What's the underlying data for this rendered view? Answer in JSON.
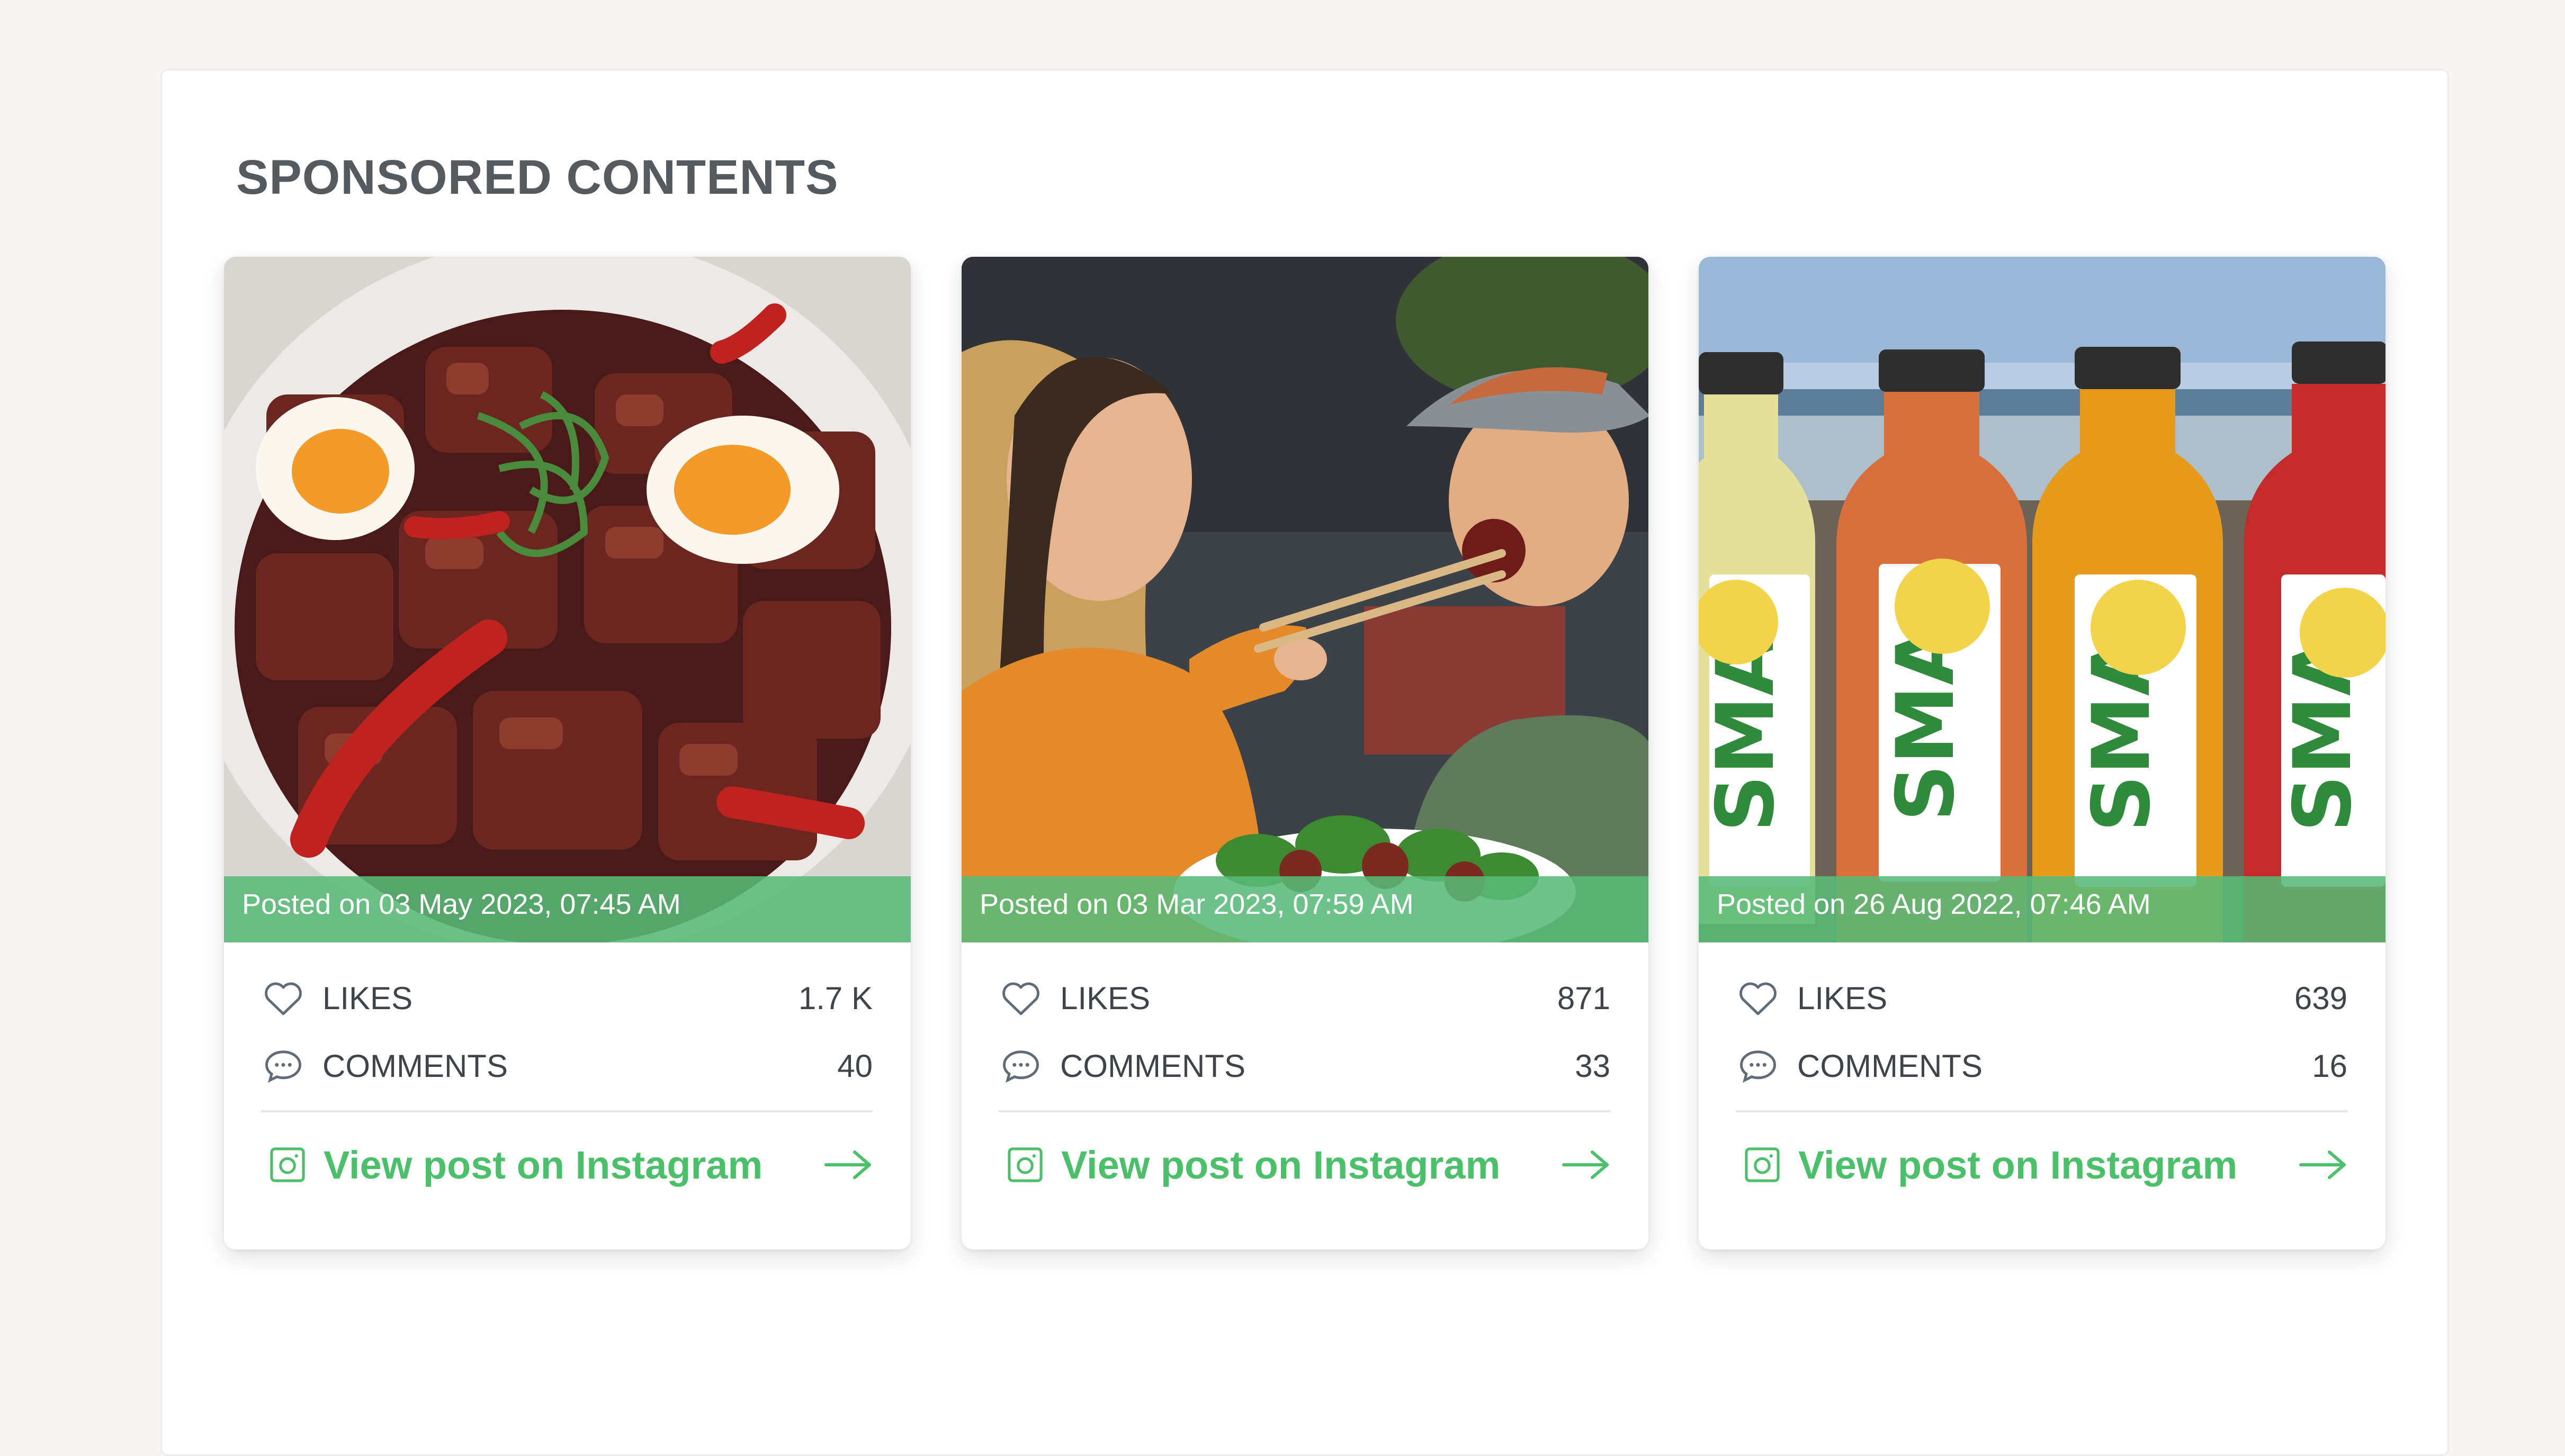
{
  "section": {
    "title": "SPONSORED CONTENTS"
  },
  "colors": {
    "accent_green": "#4cbf6a",
    "posted_bar": "#58b978",
    "text_dark": "#3e4449"
  },
  "cards": [
    {
      "posted": "Posted on 03 May 2023, 07:45 AM",
      "likes_label": "LIKES",
      "likes_value": "1.7 K",
      "comments_label": "COMMENTS",
      "comments_value": "40",
      "cta": "View post on Instagram",
      "image_subject": "braised pork belly with eggs and chili"
    },
    {
      "posted": "Posted on 03 Mar 2023, 07:59 AM",
      "likes_label": "LIKES",
      "likes_value": "871",
      "comments_label": "COMMENTS",
      "comments_value": "33",
      "cta": "View post on Instagram",
      "image_subject": "couple eating with chopsticks"
    },
    {
      "posted": "Posted on 26 Aug 2022, 07:46 AM",
      "likes_label": "LIKES",
      "likes_value": "639",
      "comments_label": "COMMENTS",
      "comments_value": "16",
      "cta": "View post on Instagram",
      "image_subject": "sea moss lemonade bottles",
      "bottle_labels": [
        "SMA",
        "SMA",
        "SMA",
        "SMA"
      ]
    }
  ],
  "icons": {
    "likes": "heart-icon",
    "comments": "chat-bubble-icon",
    "instagram": "instagram-icon",
    "arrow": "arrow-right-icon"
  }
}
